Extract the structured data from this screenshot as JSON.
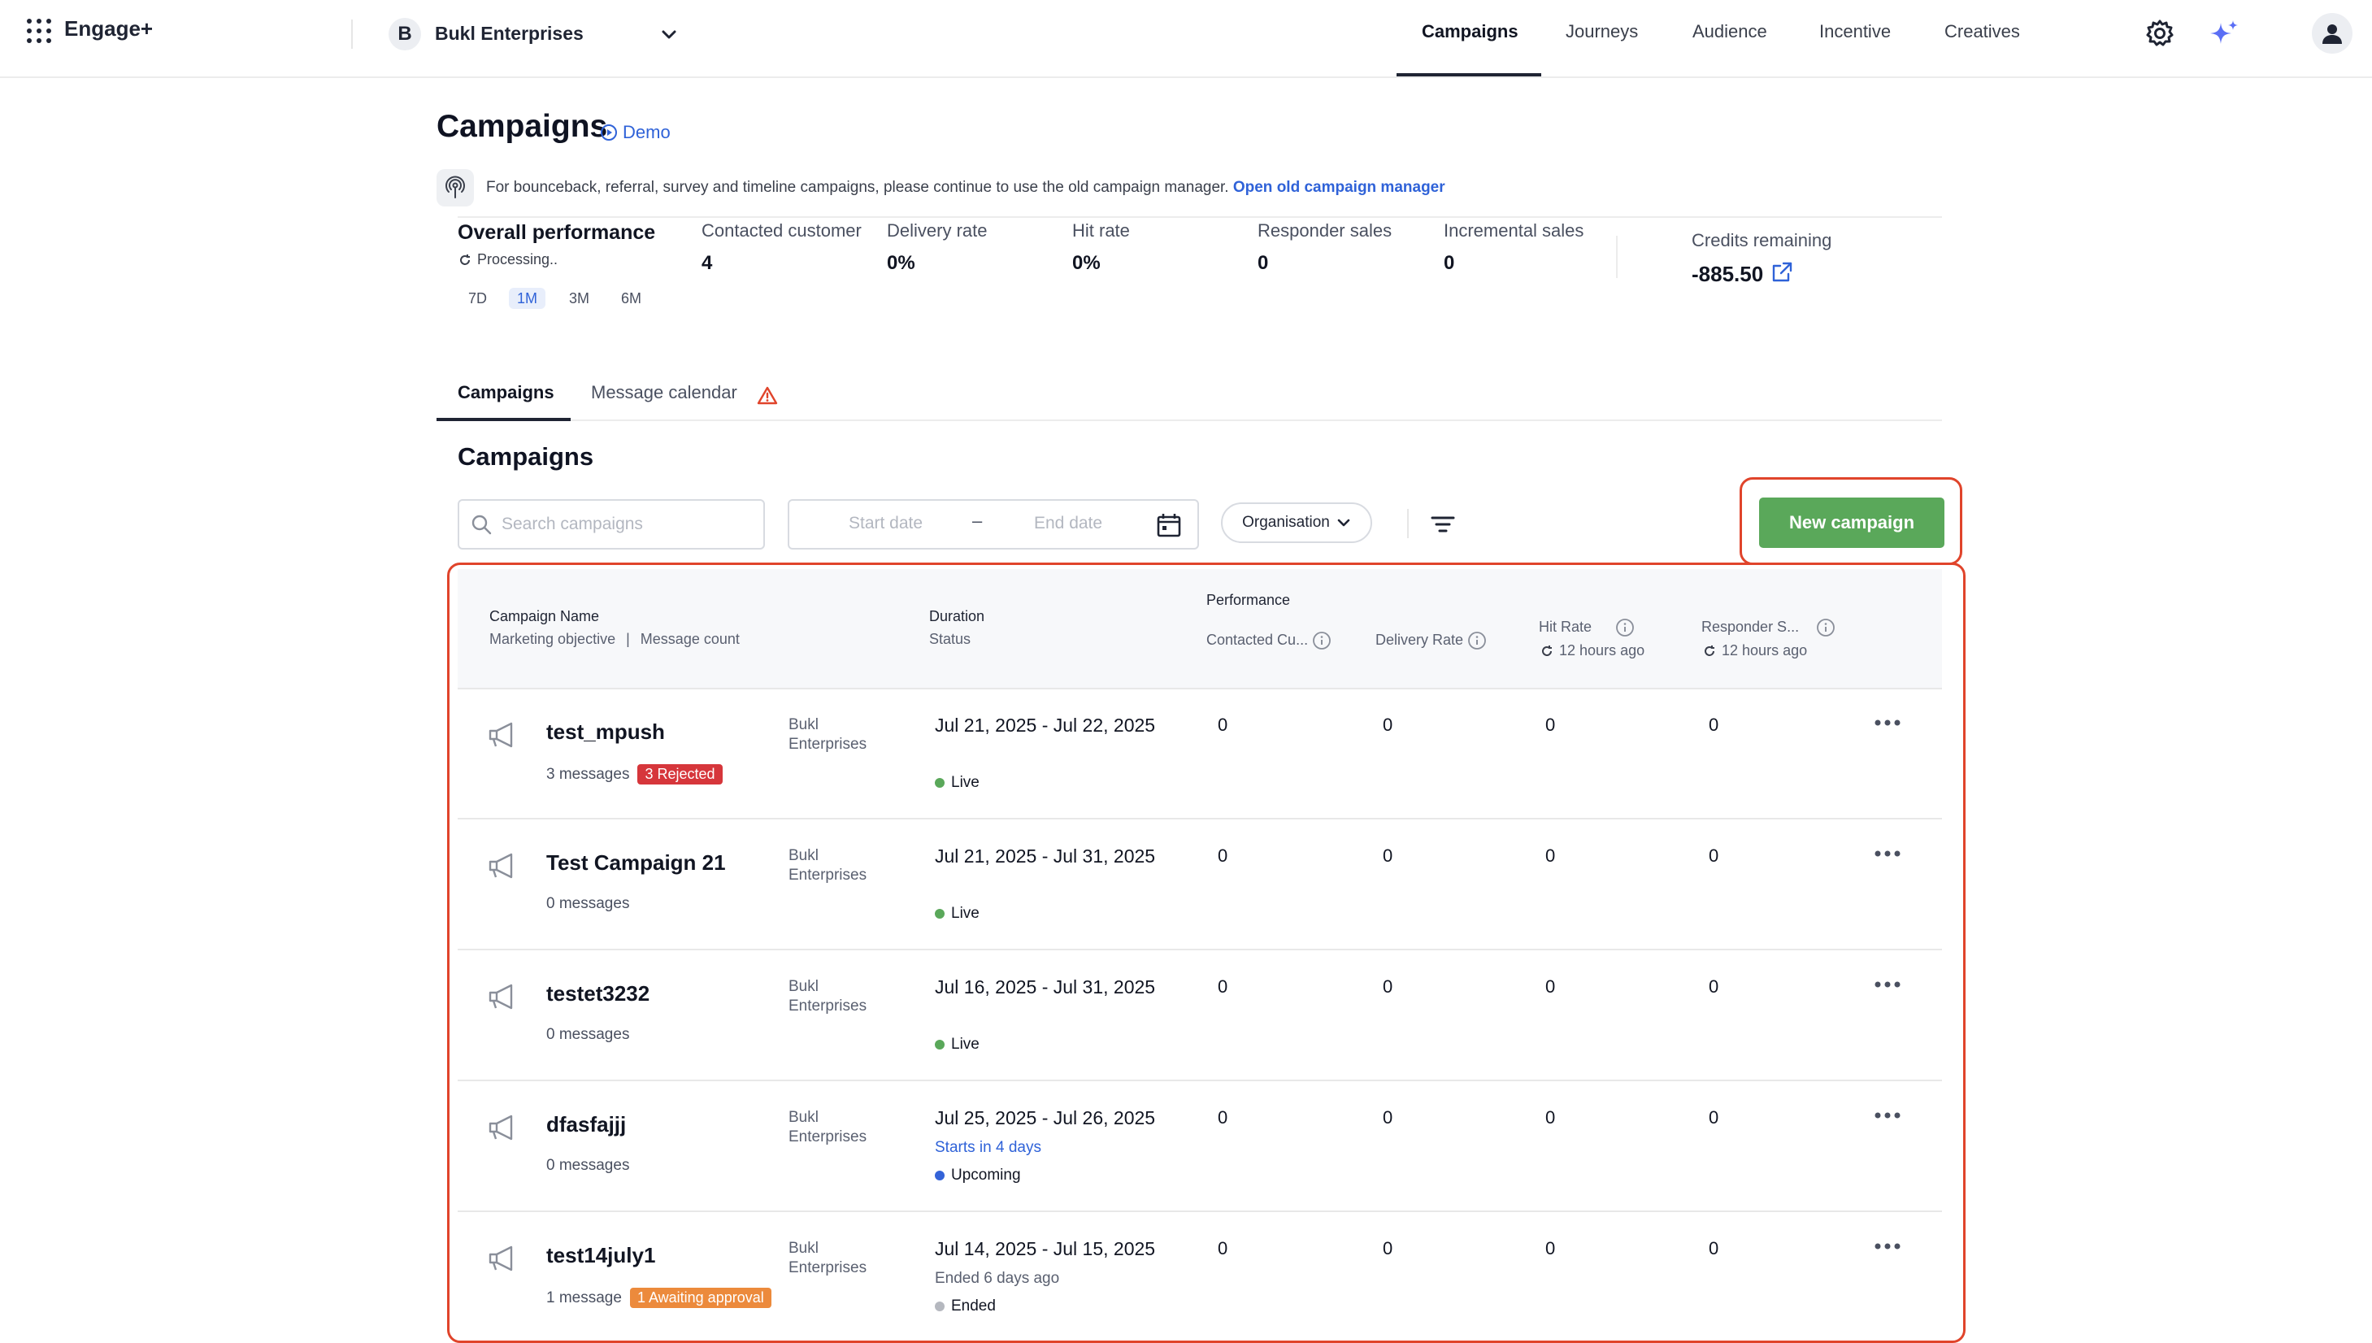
{
  "app": {
    "name": "Engage+"
  },
  "org_switcher": {
    "initial": "B",
    "name": "Bukl Enterprises"
  },
  "nav": {
    "tabs": [
      "Campaigns",
      "Journeys",
      "Audience",
      "Incentive",
      "Creatives"
    ],
    "active": "Campaigns"
  },
  "header": {
    "title": "Campaigns",
    "demo_label": "Demo",
    "notice_text": "For bounceback, referral, survey and timeline campaigns, please continue to use the old campaign manager.",
    "notice_link": "Open old campaign manager"
  },
  "performance": {
    "title": "Overall performance",
    "status": "Processing..",
    "ranges": [
      "7D",
      "1M",
      "3M",
      "6M"
    ],
    "active_range": "1M",
    "metrics": [
      {
        "label": "Contacted customer",
        "value": "4"
      },
      {
        "label": "Delivery rate",
        "value": "0%"
      },
      {
        "label": "Hit rate",
        "value": "0%"
      },
      {
        "label": "Responder sales",
        "value": "0"
      },
      {
        "label": "Incremental sales",
        "value": "0"
      }
    ],
    "credits_label": "Credits remaining",
    "credits_value": "-885.50"
  },
  "sub_tabs": [
    "Campaigns",
    "Message calendar"
  ],
  "campaigns_section": {
    "title": "Campaigns",
    "search_placeholder": "Search campaigns",
    "start_placeholder": "Start date",
    "date_separator": "–",
    "end_placeholder": "End date",
    "org_filter": "Organisation",
    "new_button": "New campaign"
  },
  "table": {
    "col_name": "Campaign Name",
    "col_name_sub_a": "Marketing objective",
    "col_name_sub_sep": "|",
    "col_name_sub_b": "Message count",
    "col_duration": "Duration",
    "col_status": "Status",
    "performance_label": "Performance",
    "col_contacted": "Contacted Cu...",
    "col_delivery": "Delivery Rate",
    "col_hit": "Hit Rate",
    "col_responder": "Responder S...",
    "updated": "12 hours ago",
    "rows": [
      {
        "name": "test_mpush",
        "messages": "3 messages",
        "badge": "3 Rejected",
        "badge_color": "#d6363b",
        "org_line1": "Bukl",
        "org_line2": "Enterprises",
        "duration": "Jul 21, 2025 - Jul 22, 2025",
        "sub": "",
        "status": "Live",
        "status_color": "#5aa85a",
        "contacted": "0",
        "delivery": "0",
        "hit": "0",
        "responder": "0"
      },
      {
        "name": "Test Campaign 21",
        "messages": "0 messages",
        "badge": "",
        "badge_color": "",
        "org_line1": "Bukl",
        "org_line2": "Enterprises",
        "duration": "Jul 21, 2025 - Jul 31, 2025",
        "sub": "",
        "status": "Live",
        "status_color": "#5aa85a",
        "contacted": "0",
        "delivery": "0",
        "hit": "0",
        "responder": "0"
      },
      {
        "name": "testet3232",
        "messages": "0 messages",
        "badge": "",
        "badge_color": "",
        "org_line1": "Bukl",
        "org_line2": "Enterprises",
        "duration": "Jul 16, 2025 - Jul 31, 2025",
        "sub": "",
        "status": "Live",
        "status_color": "#5aa85a",
        "contacted": "0",
        "delivery": "0",
        "hit": "0",
        "responder": "0"
      },
      {
        "name": "dfasfajjj",
        "messages": "0 messages",
        "badge": "",
        "badge_color": "",
        "org_line1": "Bukl",
        "org_line2": "Enterprises",
        "duration": "Jul 25, 2025 - Jul 26, 2025",
        "sub": "Starts in 4 days",
        "sub_color": "#2f62d8",
        "status": "Upcoming",
        "status_color": "#3463d8",
        "contacted": "0",
        "delivery": "0",
        "hit": "0",
        "responder": "0"
      },
      {
        "name": "test14july1",
        "messages": "1 message",
        "badge": "1 Awaiting approval",
        "badge_color": "#ec8a3c",
        "org_line1": "Bukl",
        "org_line2": "Enterprises",
        "duration": "Jul 14, 2025 - Jul 15, 2025",
        "sub": "Ended 6 days ago",
        "sub_color": "#5a6070",
        "status": "Ended",
        "status_color": "#b5b8bf",
        "contacted": "0",
        "delivery": "0",
        "hit": "0",
        "responder": "0"
      }
    ]
  },
  "colors": {
    "accent": "#2f62d8",
    "primary_button": "#5aa85a",
    "highlight": "#e0442b",
    "sparkle": "#5b6ff5"
  }
}
